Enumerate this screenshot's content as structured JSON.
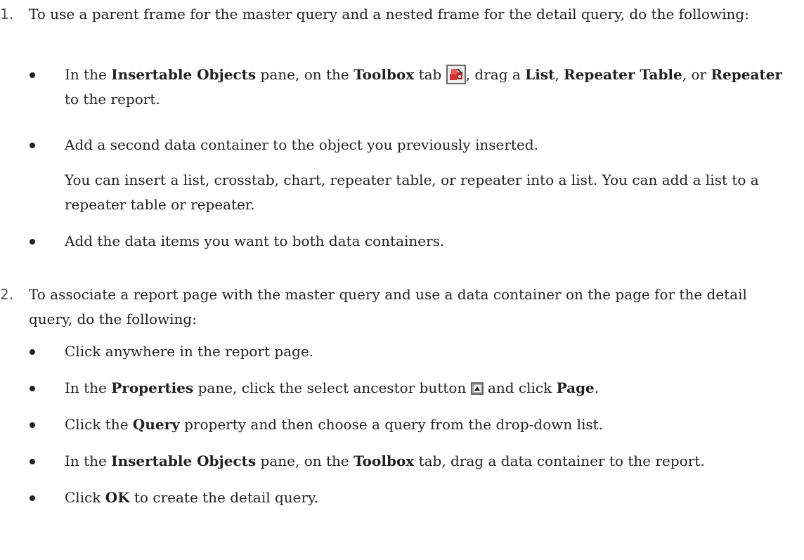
{
  "steps": [
    {
      "number": "1.",
      "text": "To use a parent frame for the master query and a nested frame for the detail query, do the following:",
      "bullets": [
        {
          "parts": [
            "In the ",
            "Insertable Objects",
            " pane, on the ",
            "Toolbox",
            " tab ",
            "",
            ", drag a ",
            "List",
            ", ",
            "Repeater Table",
            ", or ",
            "Repeater",
            " to the report."
          ]
        },
        {
          "text": "Add a second data container to the object you previously inserted.",
          "note": "You can insert a list, crosstab, chart, repeater table, or repeater into a list. You can add a list to a repeater table or repeater."
        },
        {
          "text": "Add the data items you want to both data containers."
        }
      ]
    },
    {
      "number": "2.",
      "text": "To associate a report page with the master query and use a data container on the page for the detail query, do the following:",
      "bullets": [
        {
          "text": "Click anywhere in the report page."
        },
        {
          "parts": [
            "In the ",
            "Properties",
            " pane, click the select ancestor button ",
            "",
            " and click ",
            "Page",
            "."
          ]
        },
        {
          "parts": [
            "Click the ",
            "Query",
            " property and then choose a query from the drop-down list."
          ]
        },
        {
          "parts": [
            "In the ",
            "Insertable Objects",
            " pane, on the ",
            "Toolbox",
            " tab, drag a data container to the report."
          ]
        },
        {
          "parts": [
            "Click ",
            "OK",
            " to create the detail query."
          ]
        }
      ]
    }
  ],
  "icons": {
    "toolbox": "toolbox-icon",
    "select_ancestor": "select-ancestor-icon"
  }
}
